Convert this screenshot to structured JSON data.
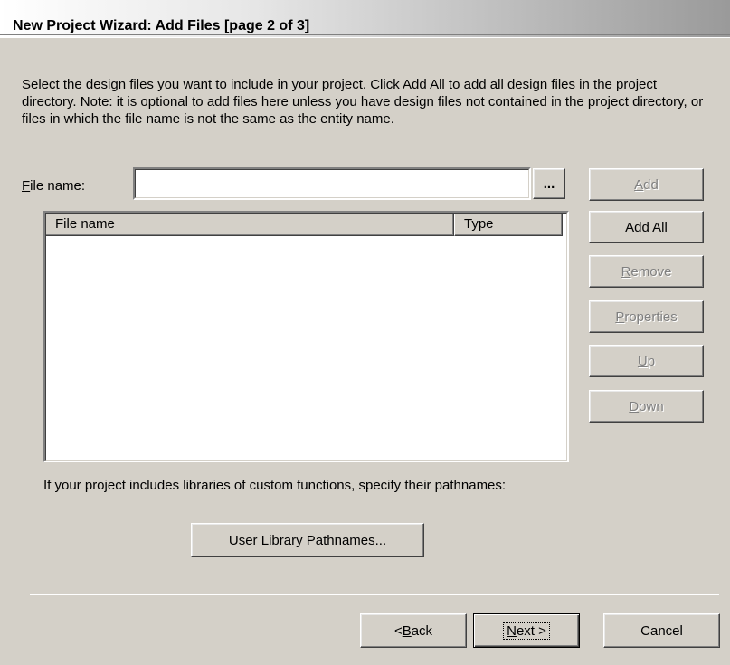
{
  "window": {
    "title": "New Project Wizard: Add Files [page 2 of 3]"
  },
  "description": "Select the design files you want to include in your project.  Click Add All to add all design files in the project directory.  Note: it is optional to add files here unless you have design files not contained in the project directory, or files in which the file name is not the same as the entity name.",
  "file_name": {
    "label_mnemonic": "F",
    "label_rest": "ile name:",
    "value": "",
    "browse_label": "..."
  },
  "file_list": {
    "columns": [
      "File name",
      "Type"
    ],
    "rows": []
  },
  "side_buttons": {
    "add": {
      "mnemonic": "A",
      "rest": "dd",
      "enabled": false
    },
    "add_all": {
      "pre": "Add A",
      "mnemonic": "l",
      "post": "l",
      "enabled": true
    },
    "remove": {
      "mnemonic": "R",
      "rest": "emove",
      "enabled": false
    },
    "properties": {
      "mnemonic": "P",
      "rest": "roperties",
      "enabled": false
    },
    "up": {
      "mnemonic": "U",
      "rest": "p",
      "enabled": false
    },
    "down": {
      "mnemonic": "D",
      "rest": "own",
      "enabled": false
    }
  },
  "library": {
    "text": "If your project includes libraries of custom functions, specify their pathnames:",
    "button_mnemonic": "U",
    "button_rest": "ser Library Pathnames..."
  },
  "footer": {
    "back_pre": "< ",
    "back_mnemonic": "B",
    "back_rest": "ack",
    "next_mnemonic": "N",
    "next_rest": "ext >",
    "cancel": "Cancel"
  }
}
